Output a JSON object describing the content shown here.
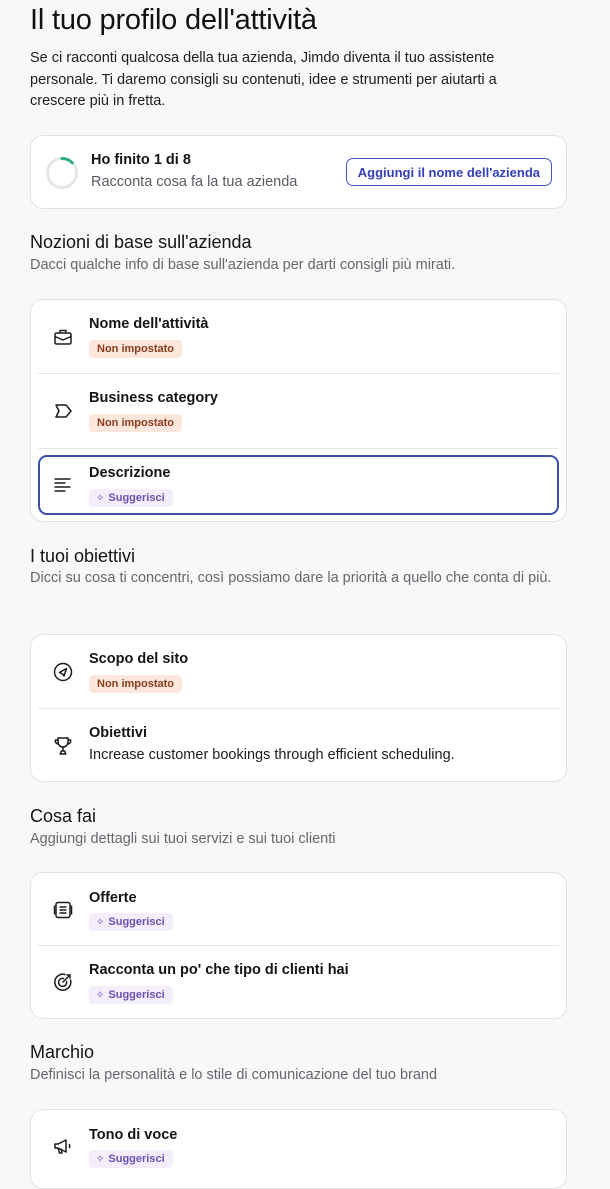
{
  "page": {
    "title": "Il tuo profilo dell'attività",
    "intro": "Se ci racconti qualcosa della tua azienda, Jimdo diventa il tuo assistente personale. Ti daremo consigli su contenuti, idee e strumenti per aiutarti a crescere più in fretta."
  },
  "progress": {
    "title": "Ho finito 1 di 8",
    "subtitle": "Racconta cosa fa la tua azienda",
    "button_label": "Aggiungi il nome dell'azienda",
    "completed": 1,
    "total": 8,
    "color": "#2bb07a"
  },
  "sections": {
    "basics": {
      "title": "Nozioni di base sull'azienda",
      "description": "Dacci qualche info di base sull'azienda per darti consigli più mirati.",
      "items": [
        {
          "label": "Nome dell'attività",
          "badge": "Non impostato",
          "icon": "briefcase-icon"
        },
        {
          "label": "Business category",
          "badge": "Non impostato",
          "icon": "tag-icon"
        },
        {
          "label": "Descrizione",
          "badge": "Suggerisci",
          "icon": "text-lines-icon"
        }
      ]
    },
    "goals": {
      "title": "I tuoi obiettivi",
      "description": "Dicci su cosa ti concentri, così possiamo dare la priorità a quello che conta di più.",
      "items": [
        {
          "label": "Scopo del sito",
          "badge": "Non impostato",
          "icon": "compass-icon"
        },
        {
          "label": "Obiettivi",
          "value": "Increase customer bookings through efficient scheduling.",
          "icon": "trophy-icon"
        }
      ]
    },
    "what_you_do": {
      "title": "Cosa fai",
      "description": "Aggiungi dettagli sui tuoi servizi e sui tuoi clienti",
      "items": [
        {
          "label": "Offerte",
          "badge": "Suggerisci",
          "icon": "list-icon"
        },
        {
          "label": "Racconta un po' che tipo di clienti hai",
          "badge": "Suggerisci",
          "icon": "target-icon"
        }
      ]
    },
    "brand": {
      "title": "Marchio",
      "description": "Definisci la personalità e lo stile di comunicazione del tuo brand",
      "items": [
        {
          "label": "Tono di voce",
          "badge": "Suggerisci",
          "icon": "megaphone-icon"
        }
      ]
    }
  },
  "colors": {
    "accent": "#3340b8",
    "unset_badge_bg": "#fde7dc",
    "suggest_badge_bg": "#f3eef9",
    "focus_border": "#3b4fa6"
  }
}
